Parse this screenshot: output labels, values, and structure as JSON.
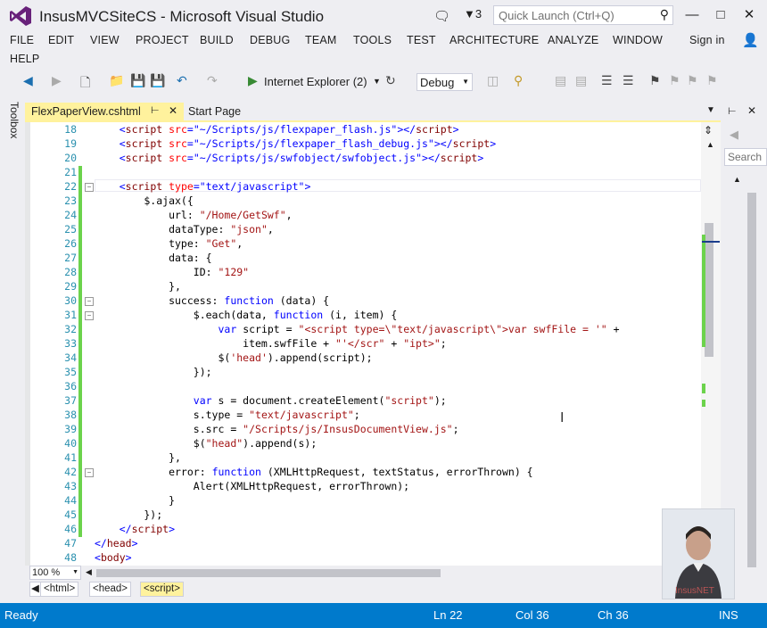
{
  "window": {
    "title": "InsusMVCSiteCS - Microsoft Visual Studio",
    "notification_count": "3",
    "quick_launch_placeholder": "Quick Launch (Ctrl+Q)"
  },
  "menu": [
    "FILE",
    "EDIT",
    "VIEW",
    "PROJECT",
    "BUILD",
    "DEBUG",
    "TEAM",
    "TOOLS",
    "TEST",
    "ARCHITECTURE",
    "ANALYZE",
    "WINDOW",
    "HELP"
  ],
  "sign_in": "Sign in",
  "toolbar": {
    "run_target": "Internet Explorer (2)",
    "configuration": "Debug"
  },
  "toolbox_label": "Toolbox",
  "tabs": [
    {
      "label": "FlexPaperView.cshtml",
      "active": true
    },
    {
      "label": "Start Page",
      "active": false
    }
  ],
  "editor": {
    "lines": [
      {
        "n": "18",
        "segs": [
          [
            "    ",
            ""
          ],
          [
            "<",
            "dv"
          ],
          [
            "script",
            "tag"
          ],
          [
            " src",
            "att"
          ],
          [
            "=",
            "dv"
          ],
          [
            "\"~/Scripts/js/flexpaper_flash.js\"",
            "dv"
          ],
          [
            "></",
            "dv"
          ],
          [
            "script",
            "tag"
          ],
          [
            ">",
            "dv"
          ]
        ]
      },
      {
        "n": "19",
        "segs": [
          [
            "    ",
            ""
          ],
          [
            "<",
            "dv"
          ],
          [
            "script",
            "tag"
          ],
          [
            " src",
            "att"
          ],
          [
            "=",
            "dv"
          ],
          [
            "\"~/Scripts/js/flexpaper_flash_debug.js\"",
            "dv"
          ],
          [
            "></",
            "dv"
          ],
          [
            "script",
            "tag"
          ],
          [
            ">",
            "dv"
          ]
        ]
      },
      {
        "n": "20",
        "segs": [
          [
            "    ",
            ""
          ],
          [
            "<",
            "dv"
          ],
          [
            "script",
            "tag"
          ],
          [
            " src",
            "att"
          ],
          [
            "=",
            "dv"
          ],
          [
            "\"~/Scripts/js/swfobject/swfobject.js\"",
            "dv"
          ],
          [
            "></",
            "dv"
          ],
          [
            "script",
            "tag"
          ],
          [
            ">",
            "dv"
          ]
        ]
      },
      {
        "n": "21",
        "segs": []
      },
      {
        "n": "22",
        "segs": [
          [
            "    ",
            ""
          ],
          [
            "<",
            "dv"
          ],
          [
            "script",
            "tag"
          ],
          [
            " type",
            "att"
          ],
          [
            "=",
            "dv"
          ],
          [
            "\"text/javascript\"",
            "dv"
          ],
          [
            ">",
            "dv"
          ]
        ]
      },
      {
        "n": "23",
        "segs": [
          [
            "        $.ajax({",
            ""
          ]
        ]
      },
      {
        "n": "24",
        "segs": [
          [
            "            url: ",
            ""
          ],
          [
            "\"/Home/GetSwf\"",
            "str"
          ],
          [
            ",",
            ""
          ]
        ]
      },
      {
        "n": "25",
        "segs": [
          [
            "            dataType: ",
            ""
          ],
          [
            "\"json\"",
            "str"
          ],
          [
            ",",
            ""
          ]
        ]
      },
      {
        "n": "26",
        "segs": [
          [
            "            type: ",
            ""
          ],
          [
            "\"Get\"",
            "str"
          ],
          [
            ",",
            ""
          ]
        ]
      },
      {
        "n": "27",
        "segs": [
          [
            "            data: {",
            ""
          ]
        ]
      },
      {
        "n": "28",
        "segs": [
          [
            "                ID: ",
            ""
          ],
          [
            "\"129\"",
            "str"
          ]
        ]
      },
      {
        "n": "29",
        "segs": [
          [
            "            },",
            ""
          ]
        ]
      },
      {
        "n": "30",
        "segs": [
          [
            "            success: ",
            ""
          ],
          [
            "function",
            "kw"
          ],
          [
            " (data) {",
            ""
          ]
        ]
      },
      {
        "n": "31",
        "segs": [
          [
            "                $.each(data, ",
            ""
          ],
          [
            "function",
            "kw"
          ],
          [
            " (i, item) {",
            ""
          ]
        ]
      },
      {
        "n": "32",
        "segs": [
          [
            "                    ",
            ""
          ],
          [
            "var",
            "kw"
          ],
          [
            " script = ",
            ""
          ],
          [
            "\"<script type=\\\"text/javascript\\\">var swfFile = '\"",
            "str"
          ],
          [
            " +",
            ""
          ]
        ]
      },
      {
        "n": "33",
        "segs": [
          [
            "                        item.swfFile + ",
            ""
          ],
          [
            "\"'</scr\"",
            "str"
          ],
          [
            " + ",
            ""
          ],
          [
            "\"ipt>\"",
            "str"
          ],
          [
            ";",
            ""
          ]
        ]
      },
      {
        "n": "34",
        "segs": [
          [
            "                    $(",
            ""
          ],
          [
            "'head'",
            "str"
          ],
          [
            ").append(script);",
            ""
          ]
        ]
      },
      {
        "n": "35",
        "segs": [
          [
            "                });",
            ""
          ]
        ]
      },
      {
        "n": "36",
        "segs": []
      },
      {
        "n": "37",
        "segs": [
          [
            "                ",
            ""
          ],
          [
            "var",
            "kw"
          ],
          [
            " s = document.createElement(",
            ""
          ],
          [
            "\"script\"",
            "str"
          ],
          [
            ");",
            ""
          ]
        ]
      },
      {
        "n": "38",
        "segs": [
          [
            "                s.type = ",
            ""
          ],
          [
            "\"text/javascript\"",
            "str"
          ],
          [
            ";",
            ""
          ]
        ]
      },
      {
        "n": "39",
        "segs": [
          [
            "                s.src = ",
            ""
          ],
          [
            "\"/Scripts/js/InsusDocumentView.js\"",
            "str"
          ],
          [
            ";",
            ""
          ]
        ]
      },
      {
        "n": "40",
        "segs": [
          [
            "                $(",
            ""
          ],
          [
            "\"head\"",
            "str"
          ],
          [
            ").append(s);",
            ""
          ]
        ]
      },
      {
        "n": "41",
        "segs": [
          [
            "            },",
            ""
          ]
        ]
      },
      {
        "n": "42",
        "segs": [
          [
            "            error: ",
            ""
          ],
          [
            "function",
            "kw"
          ],
          [
            " (XMLHttpRequest, textStatus, errorThrown) {",
            ""
          ]
        ]
      },
      {
        "n": "43",
        "segs": [
          [
            "                Alert(XMLHttpRequest, errorThrown);",
            ""
          ]
        ]
      },
      {
        "n": "44",
        "segs": [
          [
            "            }",
            ""
          ]
        ]
      },
      {
        "n": "45",
        "segs": [
          [
            "        });",
            ""
          ]
        ]
      },
      {
        "n": "46",
        "segs": [
          [
            "    ",
            ""
          ],
          [
            "</",
            "dv"
          ],
          [
            "script",
            "tag"
          ],
          [
            ">",
            "dv"
          ]
        ]
      },
      {
        "n": "47",
        "segs": [
          [
            "</",
            "dv"
          ],
          [
            "head",
            "tag"
          ],
          [
            ">",
            "dv"
          ]
        ]
      },
      {
        "n": "48",
        "segs": [
          [
            "<",
            "dv"
          ],
          [
            "body",
            "tag"
          ],
          [
            ">",
            "dv"
          ]
        ]
      }
    ]
  },
  "right_panel": {
    "search_placeholder": "Search"
  },
  "zoom": "100 %",
  "breadcrumbs": [
    "<html>",
    "<head>",
    "<script>"
  ],
  "watermark": "InsusNET",
  "status": {
    "state": "Ready",
    "line": "Ln 22",
    "col": "Col 36",
    "ch": "Ch 36",
    "mode": "INS"
  },
  "colors": {
    "accent": "#007acc",
    "active_tab": "#fff29d",
    "change_bar": "#6cd34c"
  }
}
